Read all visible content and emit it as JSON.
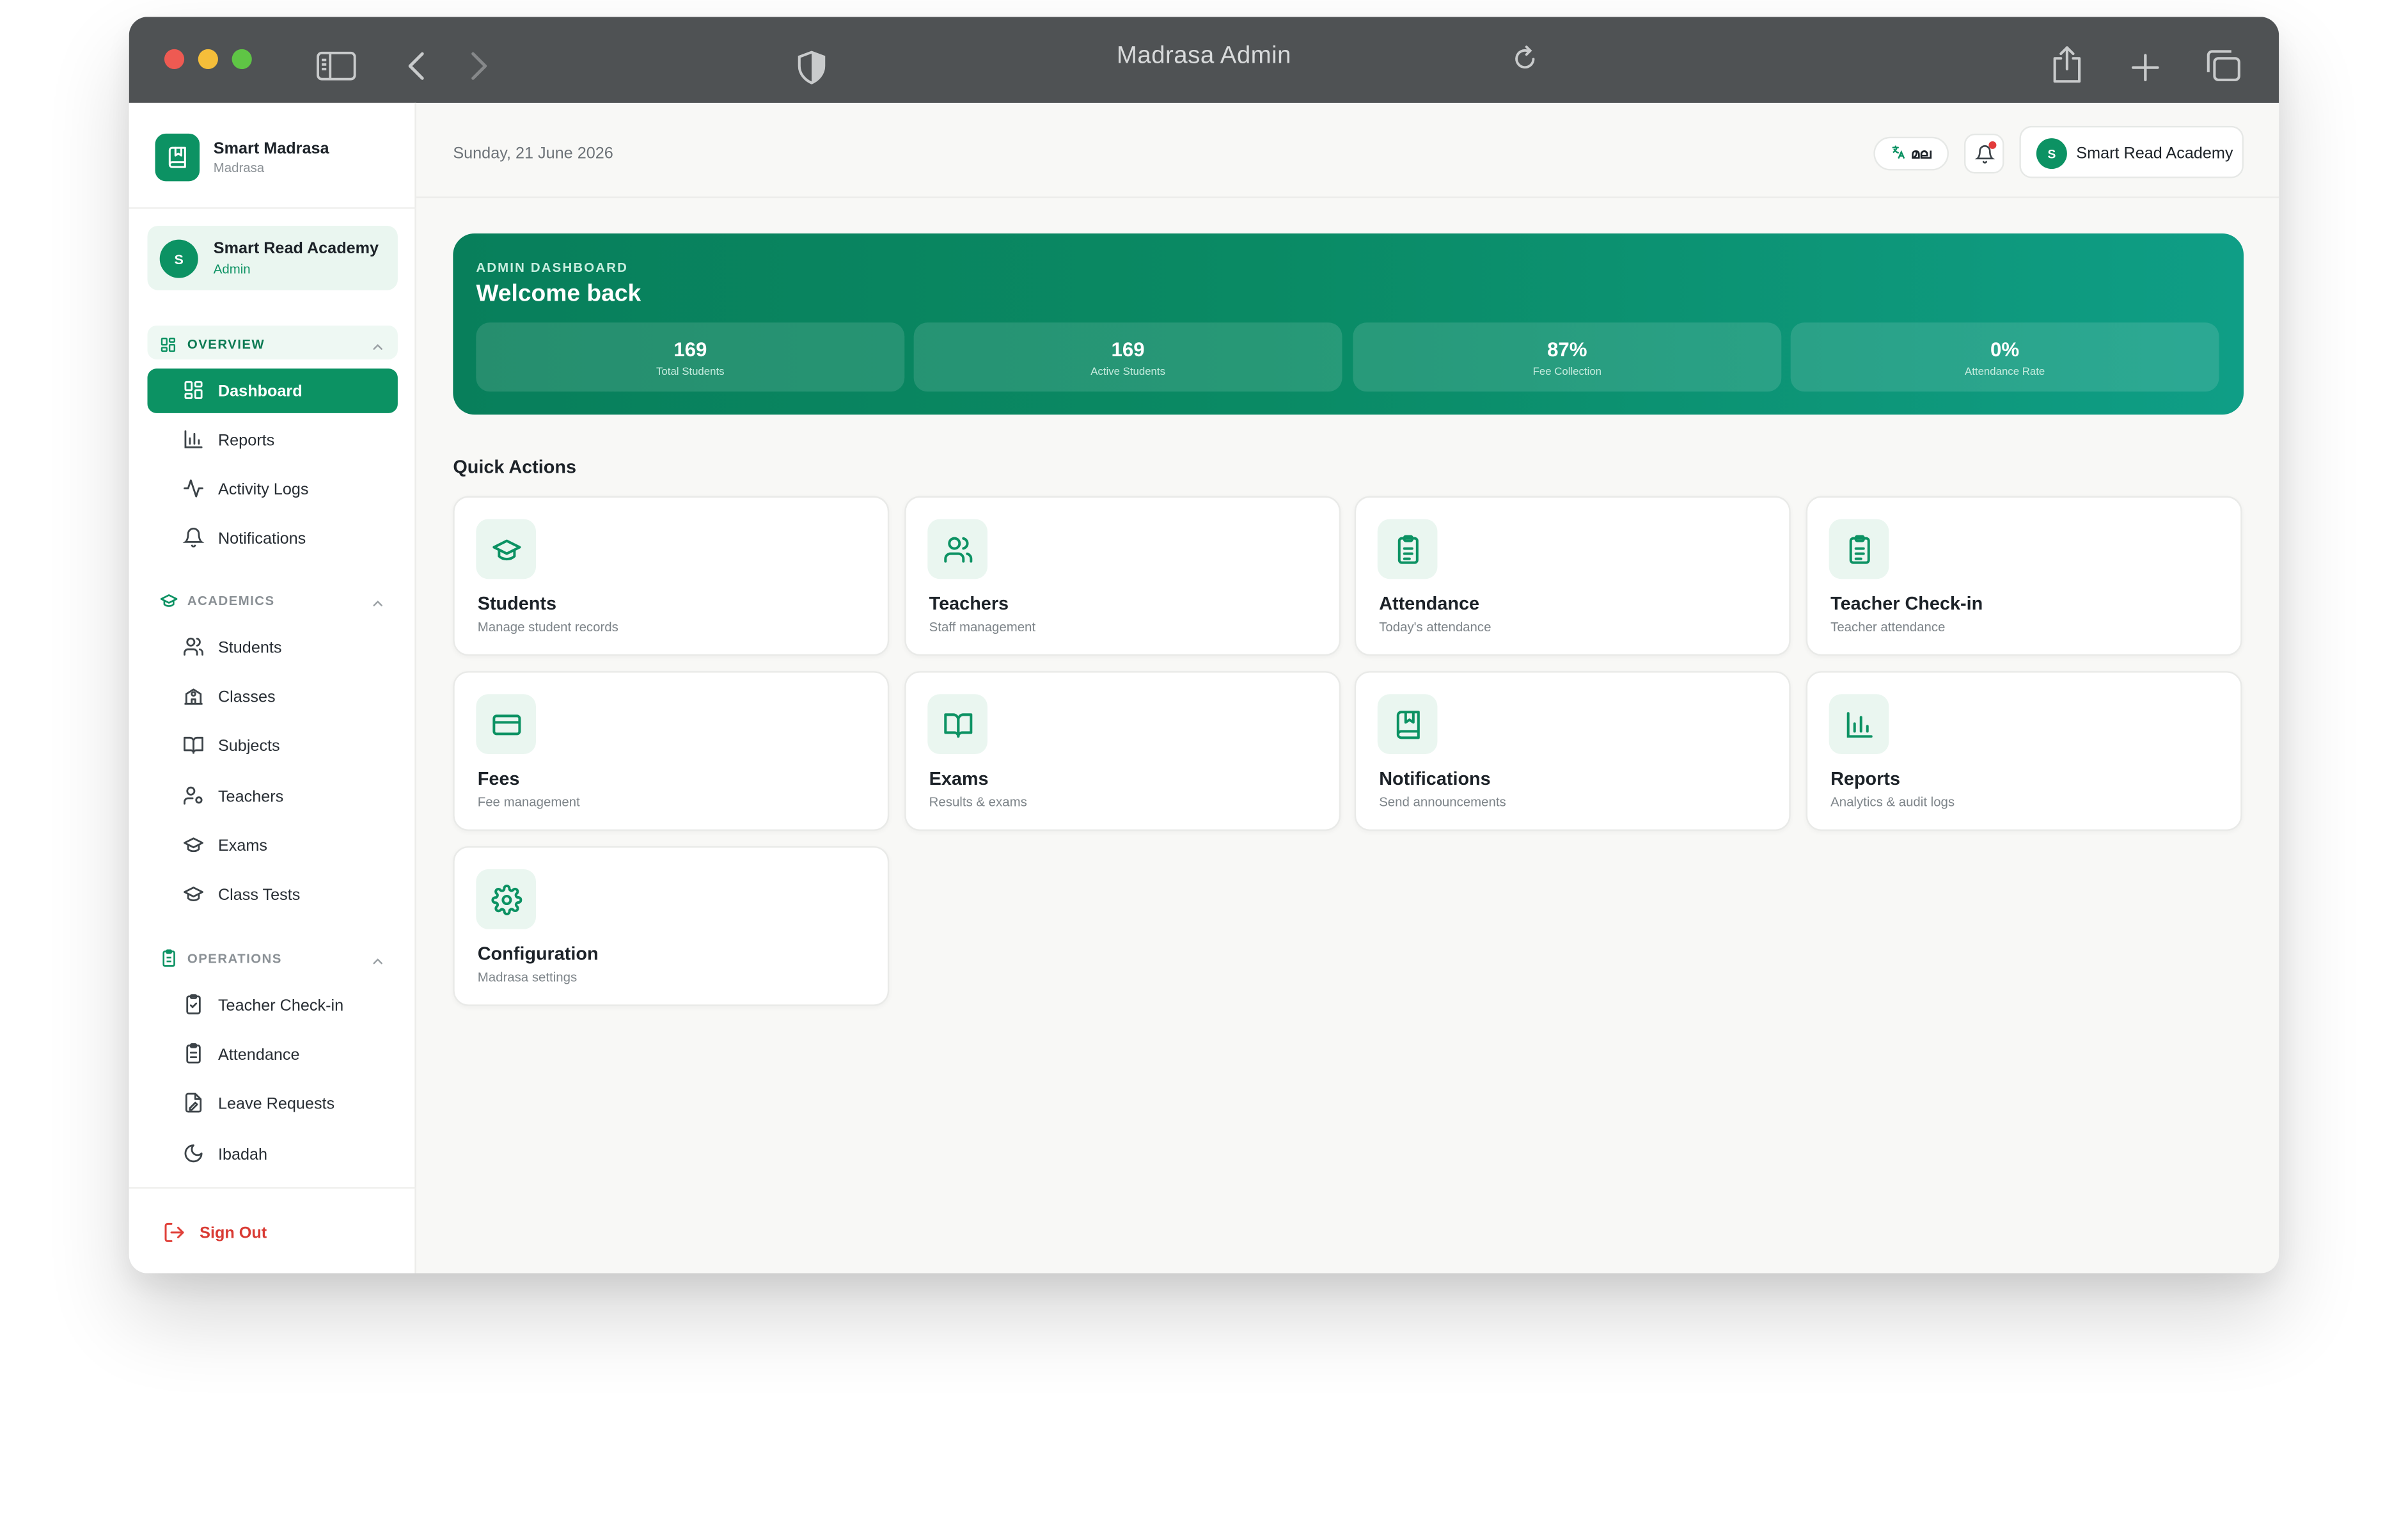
{
  "window": {
    "title": "Madrasa Admin"
  },
  "brand": {
    "name": "Smart Madrasa",
    "subtitle": "Madrasa"
  },
  "account": {
    "initial": "S",
    "name": "Smart Read Academy",
    "role": "Admin"
  },
  "sidebar": {
    "sections": [
      {
        "label": "OVERVIEW",
        "items": [
          {
            "label": "Dashboard",
            "icon": "layout-grid-icon",
            "active": true
          },
          {
            "label": "Reports",
            "icon": "bar-chart-icon"
          },
          {
            "label": "Activity Logs",
            "icon": "activity-icon"
          },
          {
            "label": "Notifications",
            "icon": "bell-icon"
          }
        ]
      },
      {
        "label": "ACADEMICS",
        "items": [
          {
            "label": "Students",
            "icon": "users-icon"
          },
          {
            "label": "Classes",
            "icon": "school-icon"
          },
          {
            "label": "Subjects",
            "icon": "book-open-icon"
          },
          {
            "label": "Teachers",
            "icon": "user-cog-icon"
          },
          {
            "label": "Exams",
            "icon": "graduation-cap-icon"
          },
          {
            "label": "Class Tests",
            "icon": "graduation-cap-icon"
          }
        ]
      },
      {
        "label": "OPERATIONS",
        "items": [
          {
            "label": "Teacher Check-in",
            "icon": "clipboard-check-icon"
          },
          {
            "label": "Attendance",
            "icon": "clipboard-list-icon"
          },
          {
            "label": "Leave Requests",
            "icon": "file-edit-icon"
          },
          {
            "label": "Ibadah",
            "icon": "moon-icon"
          }
        ]
      }
    ],
    "sign_out": "Sign Out"
  },
  "topbar": {
    "date": "Sunday, 21 June 2026",
    "language": "മല",
    "user_initial": "S",
    "user_name": "Smart Read Academy"
  },
  "hero": {
    "kicker": "ADMIN DASHBOARD",
    "title": "Welcome back",
    "stats": [
      {
        "value": "169",
        "label": "Total Students"
      },
      {
        "value": "169",
        "label": "Active Students"
      },
      {
        "value": "87%",
        "label": "Fee Collection"
      },
      {
        "value": "0%",
        "label": "Attendance Rate"
      }
    ]
  },
  "quick_actions": {
    "title": "Quick Actions",
    "cards": [
      {
        "title": "Students",
        "subtitle": "Manage student records",
        "icon": "graduation-cap-icon"
      },
      {
        "title": "Teachers",
        "subtitle": "Staff management",
        "icon": "users-icon"
      },
      {
        "title": "Attendance",
        "subtitle": "Today's attendance",
        "icon": "clipboard-list-icon"
      },
      {
        "title": "Teacher Check-in",
        "subtitle": "Teacher attendance",
        "icon": "clipboard-check-icon"
      },
      {
        "title": "Fees",
        "subtitle": "Fee management",
        "icon": "credit-card-icon"
      },
      {
        "title": "Exams",
        "subtitle": "Results & exams",
        "icon": "book-open-icon"
      },
      {
        "title": "Notifications",
        "subtitle": "Send announcements",
        "icon": "book-marked-icon"
      },
      {
        "title": "Reports",
        "subtitle": "Analytics & audit logs",
        "icon": "bar-chart-icon"
      },
      {
        "title": "Configuration",
        "subtitle": "Madrasa settings",
        "icon": "settings-icon"
      }
    ]
  },
  "colors": {
    "accent": "#0c9263",
    "hero_start": "#087f5b",
    "hero_end": "#0f9e86",
    "danger": "#d93a33",
    "titlebar": "#4f5254"
  }
}
